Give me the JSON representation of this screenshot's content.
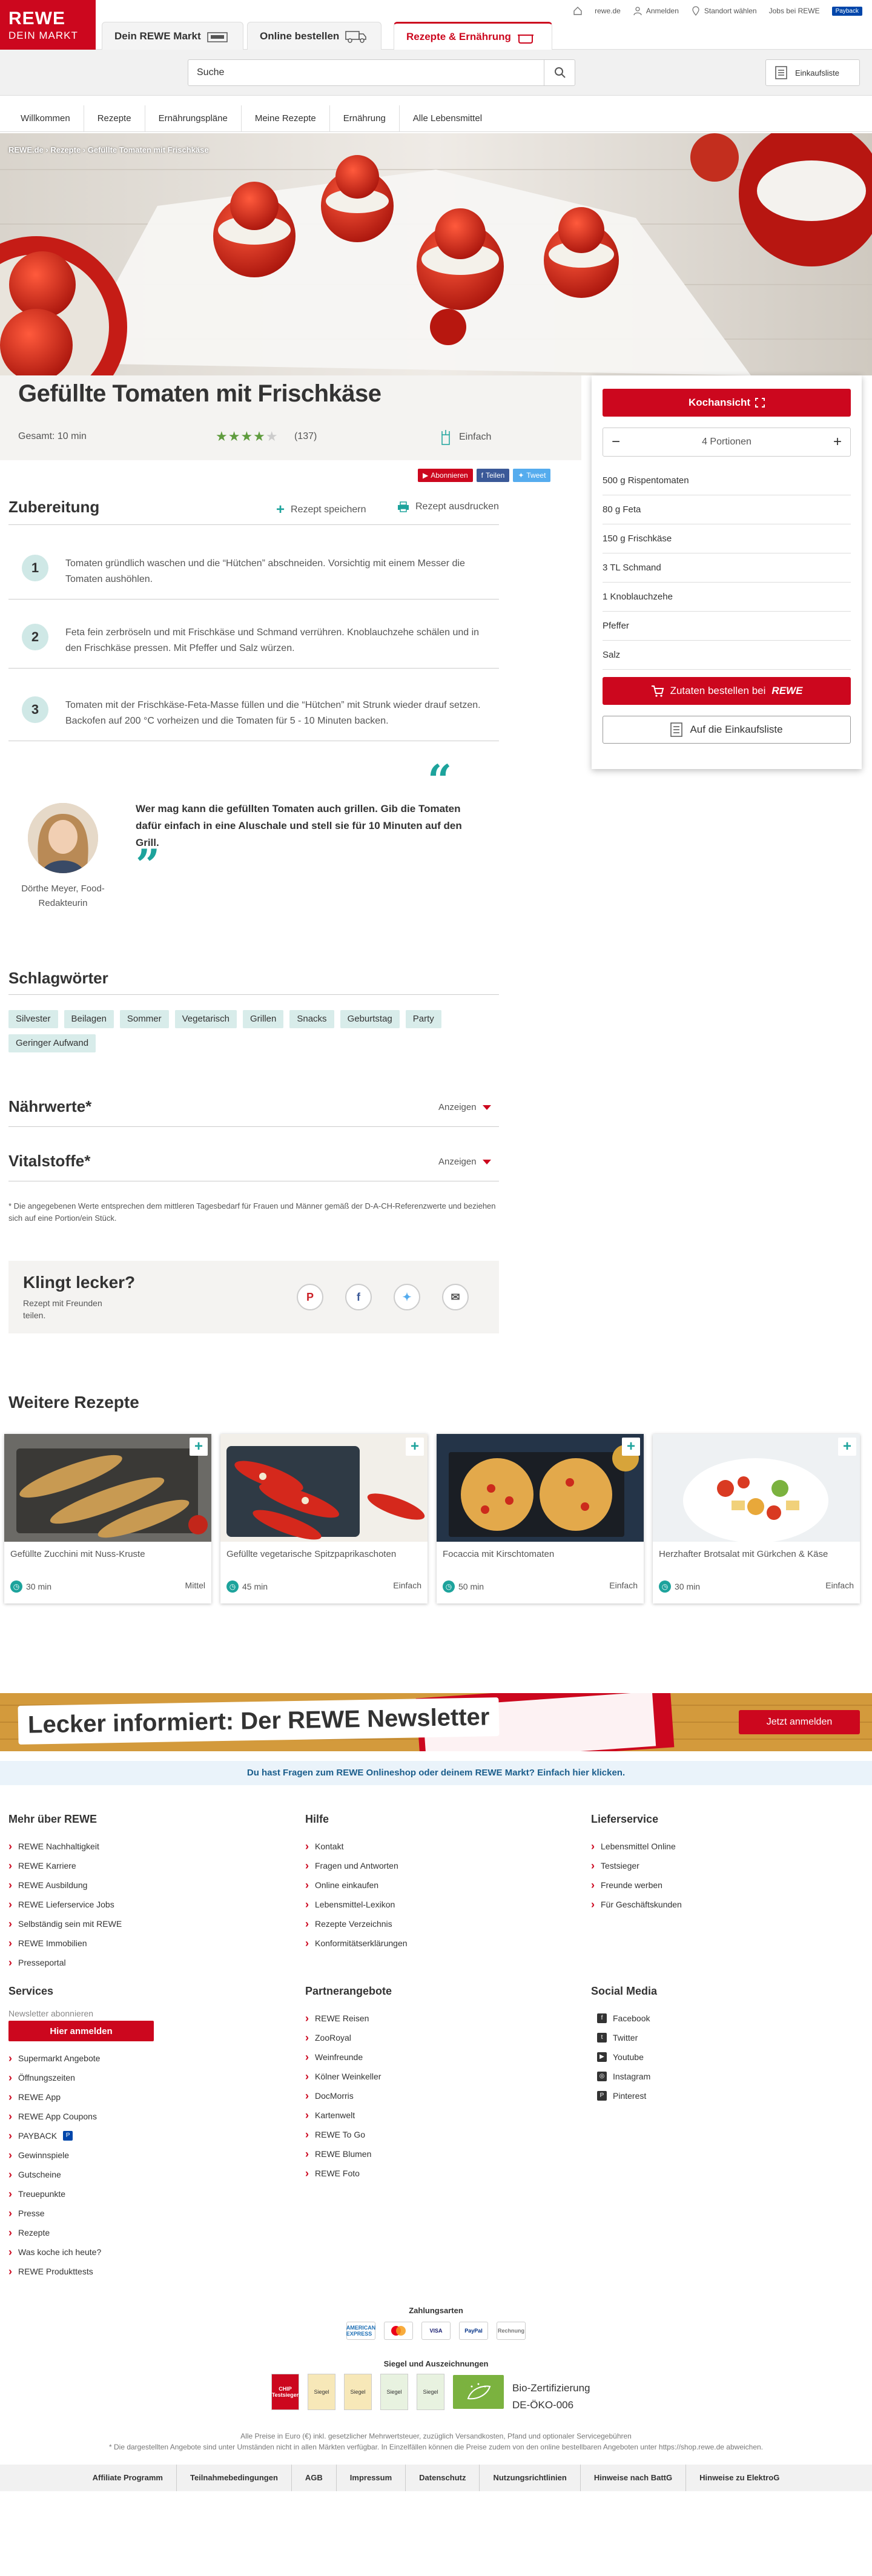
{
  "header": {
    "logo_line1": "REWE",
    "logo_line2": "DEIN MARKT",
    "util": {
      "rewe_de": "rewe.de",
      "anmelden": "Anmelden",
      "standort": "Standort wählen",
      "jobs": "Jobs bei REWE",
      "payback_logo": "Payback"
    },
    "tabs": [
      "Dein REWE Markt",
      "Online bestellen",
      "Rezepte & Ernährung"
    ],
    "search_placeholder": "Suche",
    "einkaufsliste": "Einkaufsliste",
    "nav": [
      "Willkommen",
      "Rezepte",
      "Ernährungspläne",
      "Meine Rezepte",
      "Ernährung",
      "Alle Lebensmittel"
    ]
  },
  "breadcrumb": "REWE.de › Rezepte › Gefüllte Tomaten mit Frischkäse",
  "recipe": {
    "title": "Gefüllte Tomaten mit Frischkäse",
    "gesamt": "Gesamt: 10 min",
    "rating": 4,
    "rating_count": "(137)",
    "difficulty": "Einfach",
    "social": {
      "abonnieren": "Abonnieren",
      "teilen": "Teilen",
      "tweet": "Tweet"
    }
  },
  "sidebar": {
    "kochansicht": "Kochansicht",
    "portionen": "4 Portionen",
    "ingredients": [
      "500 g Rispentomaten",
      "80 g Feta",
      "150 g Frischkäse",
      "3 TL Schmand",
      "1 Knoblauchzehe",
      "Pfeffer",
      "Salz"
    ],
    "bestellen": "Zutaten bestellen bei",
    "bestellen_brand": "REWE",
    "einkaufsliste": "Auf die Einkaufsliste"
  },
  "zubereitung": {
    "heading": "Zubereitung",
    "speichern": "Rezept speichern",
    "drucken": "Rezept ausdrucken",
    "steps": [
      {
        "num": "1",
        "text": "Tomaten gründlich waschen und die “Hütchen” abschneiden. Vorsichtig mit einem Messer die Tomaten aushöhlen."
      },
      {
        "num": "2",
        "text": "Feta fein zerbröseln und mit Frischkäse und Schmand verrühren. Knoblauchzehe schälen und in den Frischkäse pressen. Mit Pfeffer und Salz würzen."
      },
      {
        "num": "3",
        "text": "Tomaten mit der Frischkäse-Feta-Masse füllen und die “Hütchen” mit Strunk wieder drauf setzen. Backofen auf 200 °C vorheizen und die Tomaten für 5 - 10 Minuten backen."
      }
    ]
  },
  "quote": {
    "text": "Wer mag kann die gefüllten Tomaten auch grillen. Gib die Tomaten dafür einfach in eine Aluschale und stell sie für 10 Minuten auf den Grill.",
    "author": "Dörthe Meyer, Food-Redakteurin"
  },
  "tags": {
    "heading": "Schlagwörter",
    "items": [
      "Silvester",
      "Beilagen",
      "Sommer",
      "Vegetarisch",
      "Grillen",
      "Snacks",
      "Geburtstag",
      "Party",
      "Geringer Aufwand"
    ]
  },
  "naehrwerte": {
    "heading": "Nährwerte*",
    "show": "Anzeigen"
  },
  "vitalstoffe": {
    "heading": "Vitalstoffe*",
    "show": "Anzeigen"
  },
  "footnote": "* Die angegebenen Werte entsprechen dem mittleren Tagesbedarf für Frauen und Männer gemäß der D-A-CH-Referenzwerte und beziehen sich auf eine Portion/ein Stück.",
  "klingt": {
    "heading": "Klingt lecker?",
    "sub": "Rezept mit Freunden teilen."
  },
  "weitere": {
    "heading": "Weitere Rezepte",
    "cards": [
      {
        "title": "Gefüllte Zucchini mit Nuss-Kruste",
        "time": "30 min",
        "level": "Mittel"
      },
      {
        "title": "Gefüllte vegetarische Spitzpaprikaschoten",
        "time": "45 min",
        "level": "Einfach"
      },
      {
        "title": "Focaccia mit Kirschtomaten",
        "time": "50 min",
        "level": "Einfach"
      },
      {
        "title": "Herzhafter Brotsalat mit Gürkchen & Käse",
        "time": "30 min",
        "level": "Einfach"
      }
    ]
  },
  "newsletter": {
    "title": "Lecker informiert: Der REWE Newsletter",
    "button": "Jetzt anmelden"
  },
  "fragen": "Du hast Fragen zum REWE Onlineshop oder deinem REWE Markt? Einfach hier klicken.",
  "footer": {
    "mehr": {
      "heading": "Mehr über REWE",
      "items": [
        "REWE Nachhaltigkeit",
        "REWE Karriere",
        "REWE Ausbildung",
        "REWE Lieferservice Jobs",
        "Selbständig sein mit REWE",
        "REWE Immobilien",
        "Presseportal"
      ]
    },
    "hilfe": {
      "heading": "Hilfe",
      "items": [
        "Kontakt",
        "Fragen und Antworten",
        "Online einkaufen",
        "Lebensmittel-Lexikon",
        "Rezepte Verzeichnis",
        "Konformitätserklärungen"
      ]
    },
    "lieferservice": {
      "heading": "Lieferservice",
      "items": [
        "Lebensmittel Online",
        "Testsieger",
        "Freunde werben",
        "Für Geschäftskunden"
      ]
    },
    "services": {
      "heading": "Services",
      "newsletter_label": "Newsletter abonnieren",
      "anmelden": "Hier anmelden",
      "items": [
        "Supermarkt Angebote",
        "Öffnungszeiten",
        "REWE App",
        "REWE App Coupons",
        "PAYBACK",
        "Gewinnspiele",
        "Gutscheine",
        "Treuepunkte",
        "Presse",
        "Rezepte",
        "Was koche ich heute?",
        "REWE Produkttests"
      ]
    },
    "partner": {
      "heading": "Partnerangebote",
      "items": [
        "REWE Reisen",
        "ZooRoyal",
        "Weinfreunde",
        "Kölner Weinkeller",
        "DocMorris",
        "Kartenwelt",
        "REWE To Go",
        "REWE Blumen",
        "REWE Foto"
      ]
    },
    "social": {
      "heading": "Social Media",
      "items": [
        "Facebook",
        "Twitter",
        "Youtube",
        "Instagram",
        "Pinterest"
      ]
    },
    "zahlungsarten": "Zahlungsarten",
    "pay": [
      "AMERICAN EXPRESS",
      "MC",
      "VISA",
      "PayPal",
      "Rechnung"
    ],
    "siegel": "Siegel und Auszeichnungen",
    "siegel_items": [
      "CHIP Testsieger",
      "Siegel",
      "Siegel",
      "Siegel",
      "Siegel"
    ],
    "bio": "Bio-Zertifizierung",
    "bio_code": "DE-ÖKO-006",
    "legal1": "Alle Preise in Euro (€) inkl. gesetzlicher Mehrwertsteuer, zuzüglich Versandkosten, Pfand und optionaler Servicegebühren",
    "legal2": "* Die dargestellten Angebote sind unter Umständen nicht in allen Märkten verfügbar. In Einzelfällen können die Preise zudem von den online bestellbaren Angeboten unter https://shop.rewe.de abweichen.",
    "bottom": [
      "Affiliate Programm",
      "Teilnahmebedingungen",
      "AGB",
      "Impressum",
      "Datenschutz",
      "Nutzungsrichtlinien",
      "Hinweise nach BattG",
      "Hinweise zu ElektroG"
    ]
  },
  "colors": {
    "brand_red": "#cc071e",
    "teal": "#1da39c",
    "tag_bg": "#d8ecea"
  }
}
